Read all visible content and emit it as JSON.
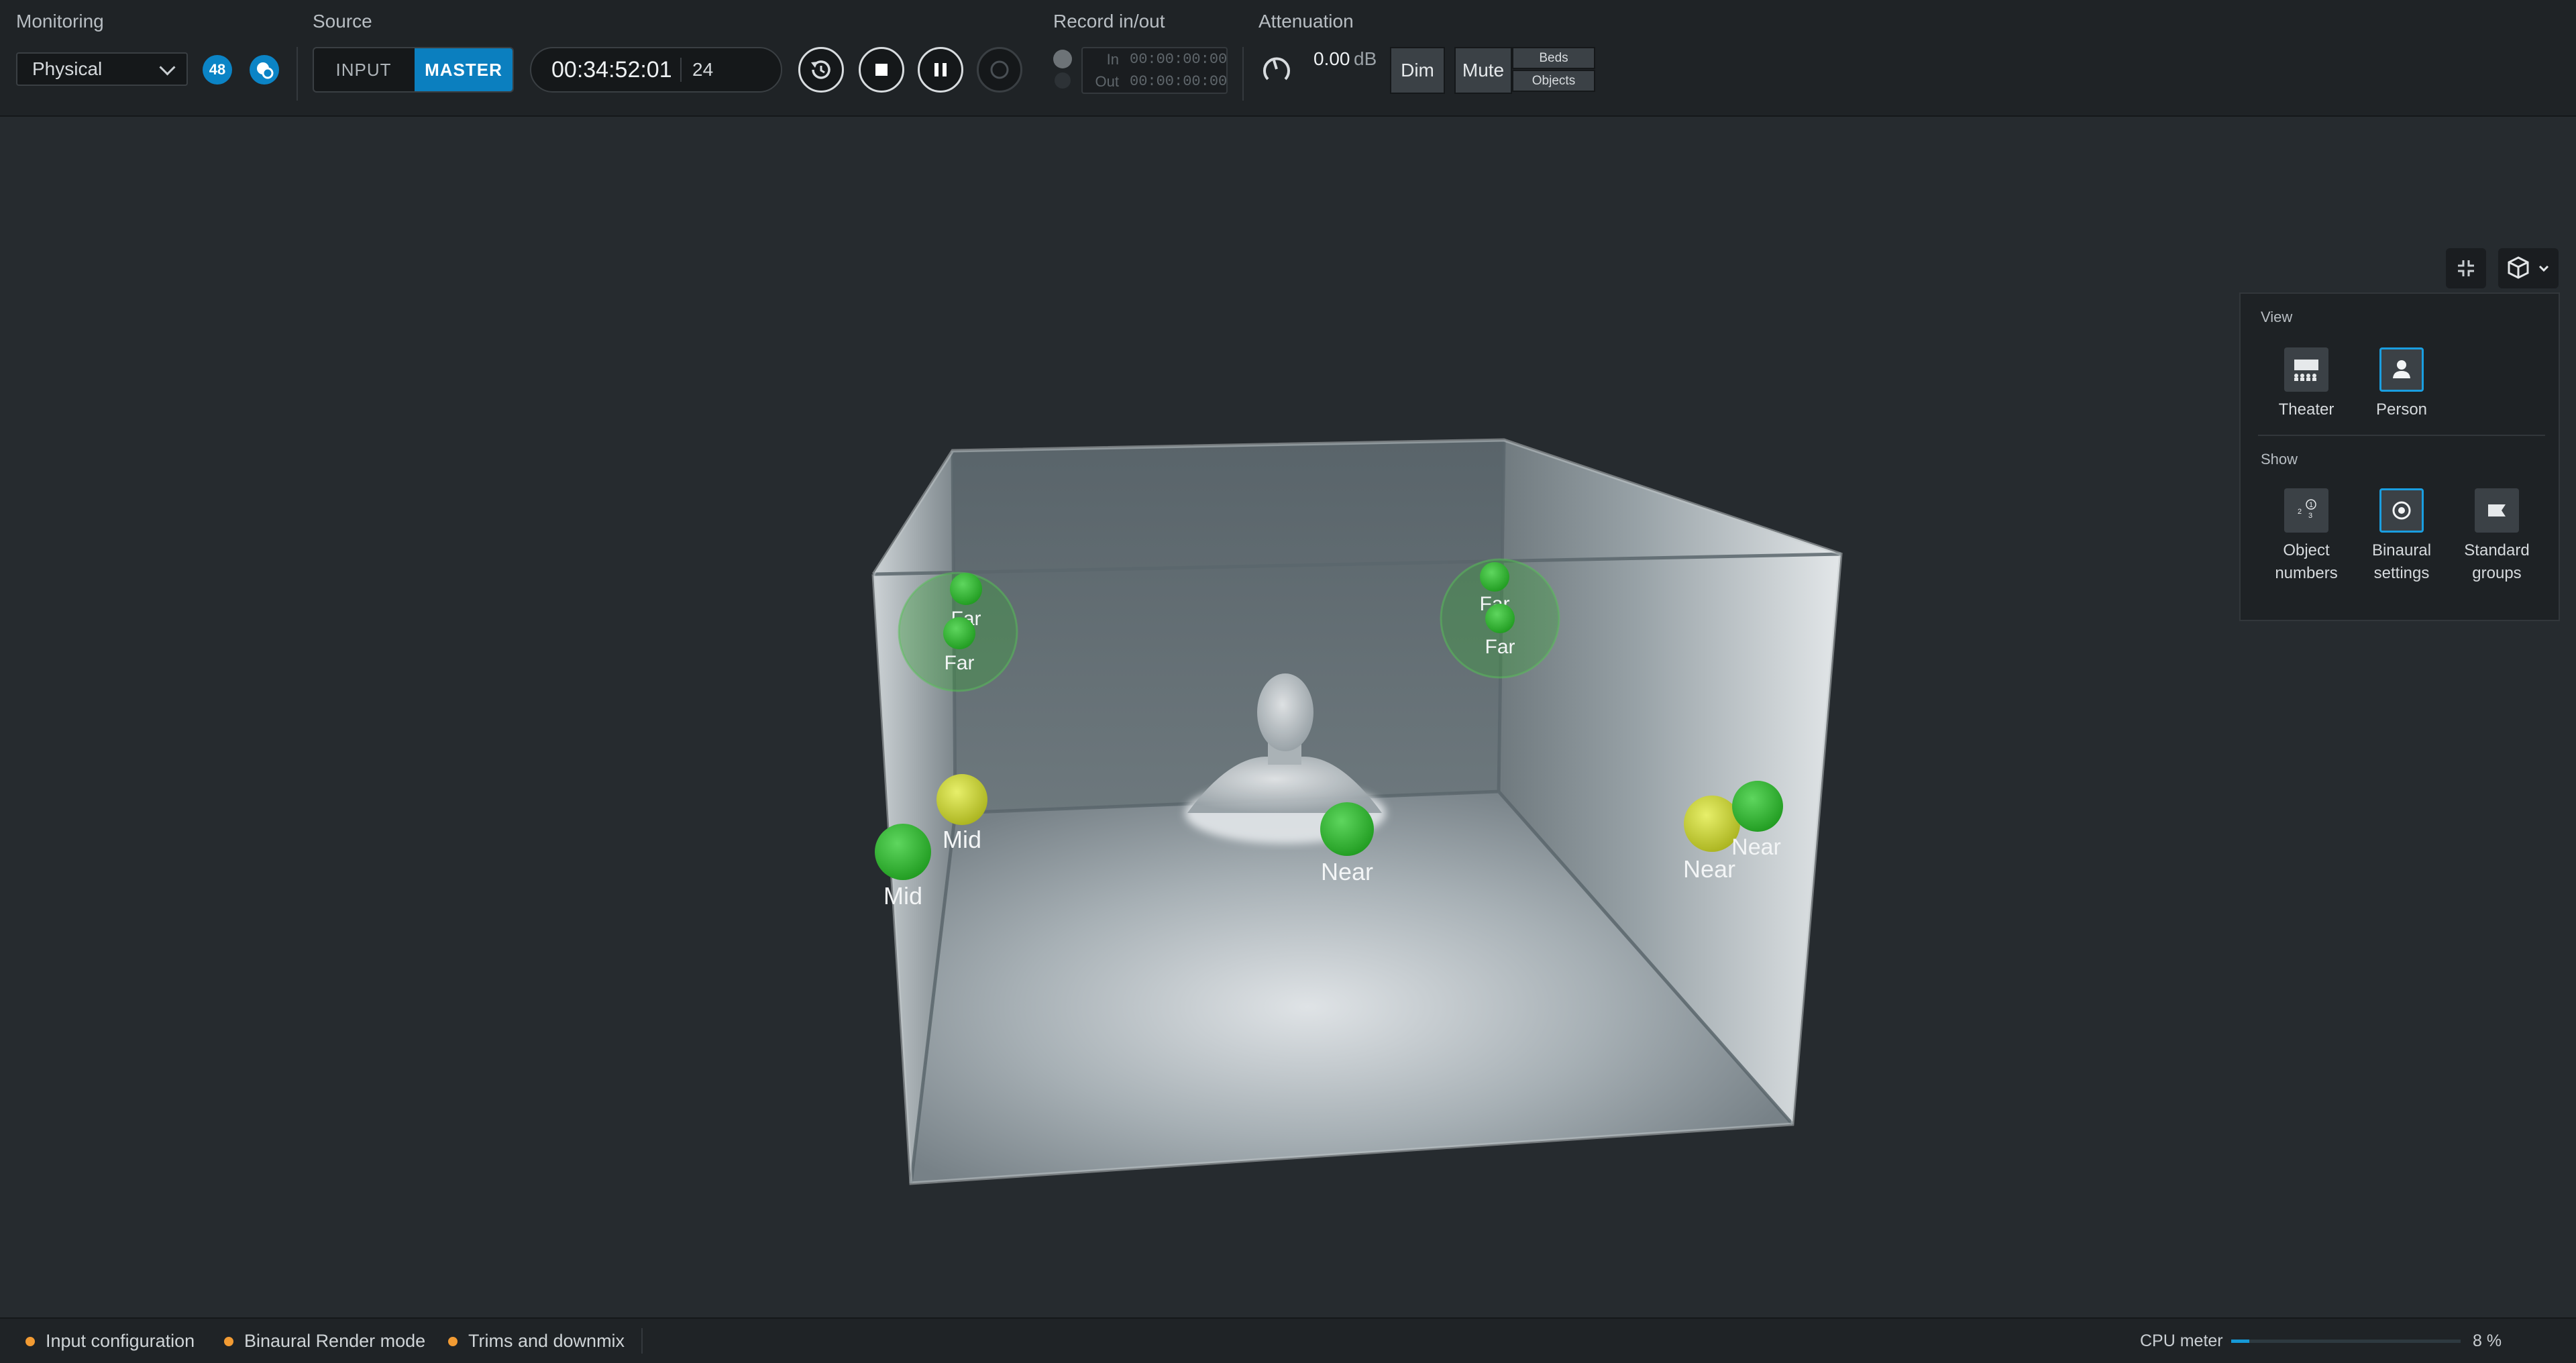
{
  "toolbar": {
    "monitoring": {
      "label": "Monitoring",
      "mode": "Physical",
      "badge": "48"
    },
    "source": {
      "label": "Source",
      "input": "INPUT",
      "master": "MASTER",
      "selected": "MASTER"
    },
    "timecode": {
      "value": "00:34:52:01",
      "frame_rate": "24"
    },
    "record": {
      "label": "Record in/out",
      "in_label": "In",
      "in_value": "00:00:00:00",
      "out_label": "Out",
      "out_value": "00:00:00:00"
    },
    "attenuation": {
      "label": "Attenuation",
      "value": "0.00",
      "unit": "dB",
      "dim": "Dim",
      "mute": "Mute",
      "beds": "Beds",
      "objects": "Objects"
    }
  },
  "scene": {
    "objects": [
      {
        "label": "Far",
        "color": "green"
      },
      {
        "label": "Far",
        "color": "green"
      },
      {
        "label": "Far",
        "color": "green"
      },
      {
        "label": "Far",
        "color": "green"
      },
      {
        "label": "Mid",
        "color": "yellow"
      },
      {
        "label": "Mid",
        "color": "green"
      },
      {
        "label": "Near",
        "color": "green"
      },
      {
        "label": "Near",
        "color": "yellow"
      },
      {
        "label": "Near",
        "color": "green"
      }
    ]
  },
  "view_panel": {
    "view_heading": "View",
    "view_items": [
      {
        "label": "Theater",
        "selected": false
      },
      {
        "label": "Person",
        "selected": true
      }
    ],
    "show_heading": "Show",
    "show_items": [
      {
        "label_line1": "Object",
        "label_line2": "numbers",
        "selected": false
      },
      {
        "label_line1": "Binaural",
        "label_line2": "settings",
        "selected": true
      },
      {
        "label_line1": "Standard",
        "label_line2": "groups",
        "selected": false
      }
    ]
  },
  "statusbar": {
    "items": [
      {
        "label": "Input configuration"
      },
      {
        "label": "Binaural Render mode"
      },
      {
        "label": "Trims and downmix"
      }
    ],
    "cpu_label": "CPU meter",
    "cpu_percent": 8,
    "cpu_value": "8 %"
  },
  "colors": {
    "accent": "#0b7fbf",
    "warning_dot": "#f29b33",
    "object_green": "#2bb52b",
    "object_yellow": "#c9d42a"
  }
}
